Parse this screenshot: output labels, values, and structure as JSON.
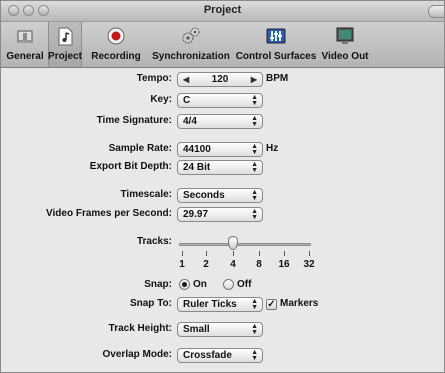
{
  "window": {
    "title": "Project"
  },
  "toolbar": {
    "items": [
      {
        "label": "General",
        "icon": "general-icon"
      },
      {
        "label": "Project",
        "icon": "project-icon",
        "selected": true
      },
      {
        "label": "Recording",
        "icon": "record-icon"
      },
      {
        "label": "Synchronization",
        "icon": "gears-icon"
      },
      {
        "label": "Control Surfaces",
        "icon": "control-surfaces-icon"
      },
      {
        "label": "Video Out",
        "icon": "monitor-icon"
      }
    ]
  },
  "settings": {
    "tempo": {
      "label": "Tempo:",
      "value": "120",
      "unit": "BPM"
    },
    "key": {
      "label": "Key:",
      "value": "C"
    },
    "time_signature": {
      "label": "Time Signature:",
      "value": "4/4"
    },
    "sample_rate": {
      "label": "Sample Rate:",
      "value": "44100",
      "unit": "Hz"
    },
    "export_bit_depth": {
      "label": "Export Bit Depth:",
      "value": "24 Bit"
    },
    "timescale": {
      "label": "Timescale:",
      "value": "Seconds"
    },
    "video_fps": {
      "label": "Video Frames per Second:",
      "value": "29.97"
    },
    "tracks": {
      "label": "Tracks:",
      "ticks": [
        "1",
        "2",
        "4",
        "8",
        "16",
        "32"
      ],
      "selected": "4"
    },
    "snap": {
      "label": "Snap:",
      "on_label": "On",
      "off_label": "Off",
      "selected": "On"
    },
    "snap_to": {
      "label": "Snap To:",
      "value": "Ruler Ticks",
      "markers_label": "Markers",
      "markers_checked": true
    },
    "track_height": {
      "label": "Track Height:",
      "value": "Small"
    },
    "overlap_mode": {
      "label": "Overlap Mode:",
      "value": "Crossfade"
    }
  }
}
